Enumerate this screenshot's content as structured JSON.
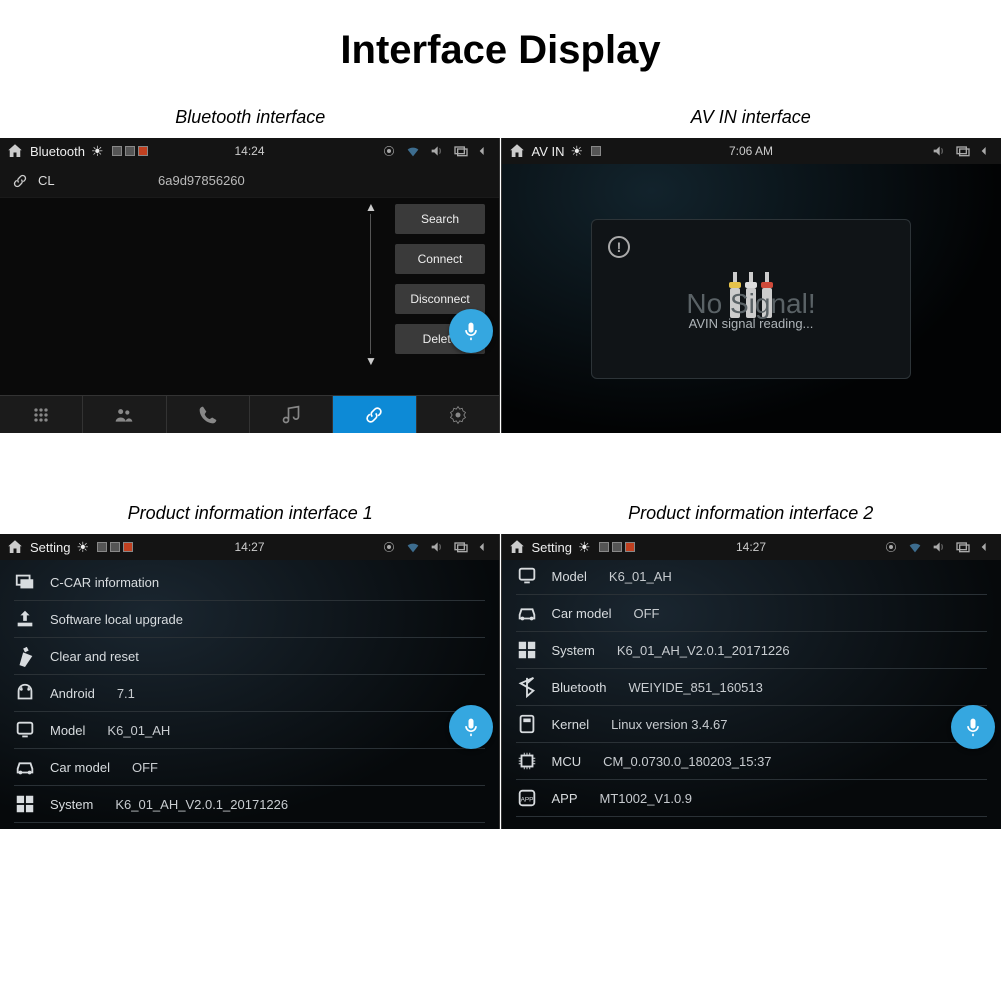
{
  "title": "Interface Display",
  "panels": {
    "bluetooth": {
      "caption": "Bluetooth interface",
      "status_title": "Bluetooth",
      "time": "14:24",
      "device": {
        "name": "CL",
        "addr": "6a9d97856260"
      },
      "buttons": {
        "search": "Search",
        "connect": "Connect",
        "disconnect": "Disconnect",
        "delete": "Delete"
      }
    },
    "avin": {
      "caption": "AV IN interface",
      "status_title": "AV IN",
      "time": "7:06 AM",
      "big_text": "No Signal!",
      "small_text": "AVIN signal reading..."
    },
    "info1": {
      "caption": "Product information interface 1",
      "status_title": "Setting",
      "time": "14:27",
      "rows": [
        {
          "label": "C-CAR information",
          "value": ""
        },
        {
          "label": "Software local upgrade",
          "value": ""
        },
        {
          "label": "Clear and reset",
          "value": ""
        },
        {
          "label": "Android",
          "value": "7.1"
        },
        {
          "label": "Model",
          "value": "K6_01_AH"
        },
        {
          "label": "Car model",
          "value": "OFF"
        },
        {
          "label": "System",
          "value": "K6_01_AH_V2.0.1_20171226"
        }
      ]
    },
    "info2": {
      "caption": "Product information interface 2",
      "status_title": "Setting",
      "time": "14:27",
      "rows": [
        {
          "label": "Model",
          "value": "K6_01_AH"
        },
        {
          "label": "Car model",
          "value": "OFF"
        },
        {
          "label": "System",
          "value": "K6_01_AH_V2.0.1_20171226"
        },
        {
          "label": "Bluetooth",
          "value": "WEIYIDE_851_160513"
        },
        {
          "label": "Kernel",
          "value": "Linux version 3.4.67"
        },
        {
          "label": "MCU",
          "value": "CM_0.0730.0_180203_15:37"
        },
        {
          "label": "APP",
          "value": "MT1002_V1.0.9"
        }
      ]
    }
  }
}
